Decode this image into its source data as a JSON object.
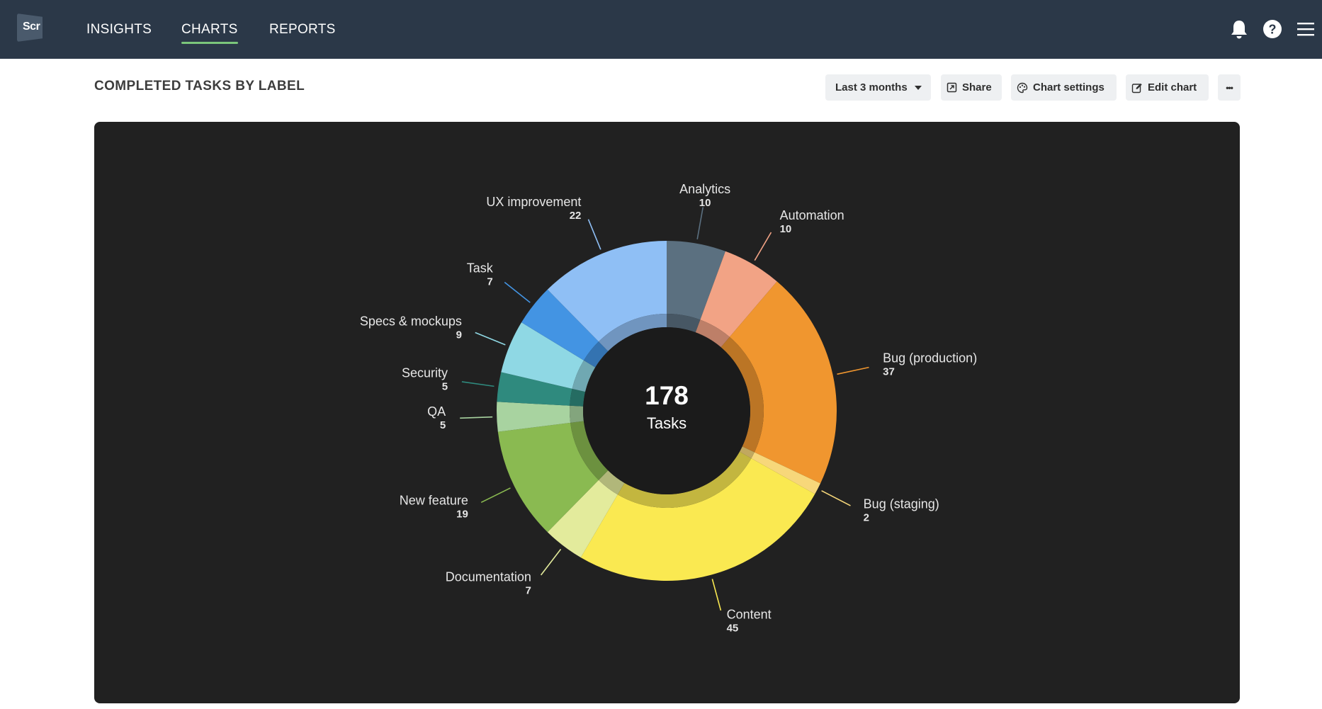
{
  "app": {
    "logo_text": "Scr",
    "nav": [
      {
        "label": "INSIGHTS"
      },
      {
        "label": "CHARTS",
        "active": true
      },
      {
        "label": "REPORTS"
      }
    ],
    "icons": [
      "bell-icon",
      "help-icon",
      "hamburger-menu-icon"
    ]
  },
  "header": {
    "title": "COMPLETED TASKS BY LABEL",
    "date_range_label": "Last 3 months",
    "share_label": "Share",
    "chart_settings_label": "Chart settings",
    "edit_chart_label": "Edit chart",
    "more_label": "•••"
  },
  "colors": {
    "topbar": "#2b3848",
    "panel": "#212121",
    "active_underline": "#7bc67b"
  },
  "chart_data": {
    "type": "pie",
    "style": "donut",
    "center_value": "178",
    "center_label": "Tasks",
    "series": [
      {
        "name": "Analytics",
        "value": 10,
        "color": "#5b7080"
      },
      {
        "name": "Automation",
        "value": 10,
        "color": "#f2a385"
      },
      {
        "name": "Bug (production)",
        "value": 37,
        "color": "#f0962f"
      },
      {
        "name": "Bug (staging)",
        "value": 2,
        "color": "#f7d77a"
      },
      {
        "name": "Content",
        "value": 45,
        "color": "#fae951"
      },
      {
        "name": "Documentation",
        "value": 7,
        "color": "#e3eb9c"
      },
      {
        "name": "New feature",
        "value": 19,
        "color": "#8aba51"
      },
      {
        "name": "QA",
        "value": 5,
        "color": "#a8d3a0"
      },
      {
        "name": "Security",
        "value": 5,
        "color": "#2f8a7e"
      },
      {
        "name": "Specs & mockups",
        "value": 9,
        "color": "#8fd8e4"
      },
      {
        "name": "Task",
        "value": 7,
        "color": "#4394e3"
      },
      {
        "name": "UX improvement",
        "value": 22,
        "color": "#8fbff5"
      }
    ]
  }
}
